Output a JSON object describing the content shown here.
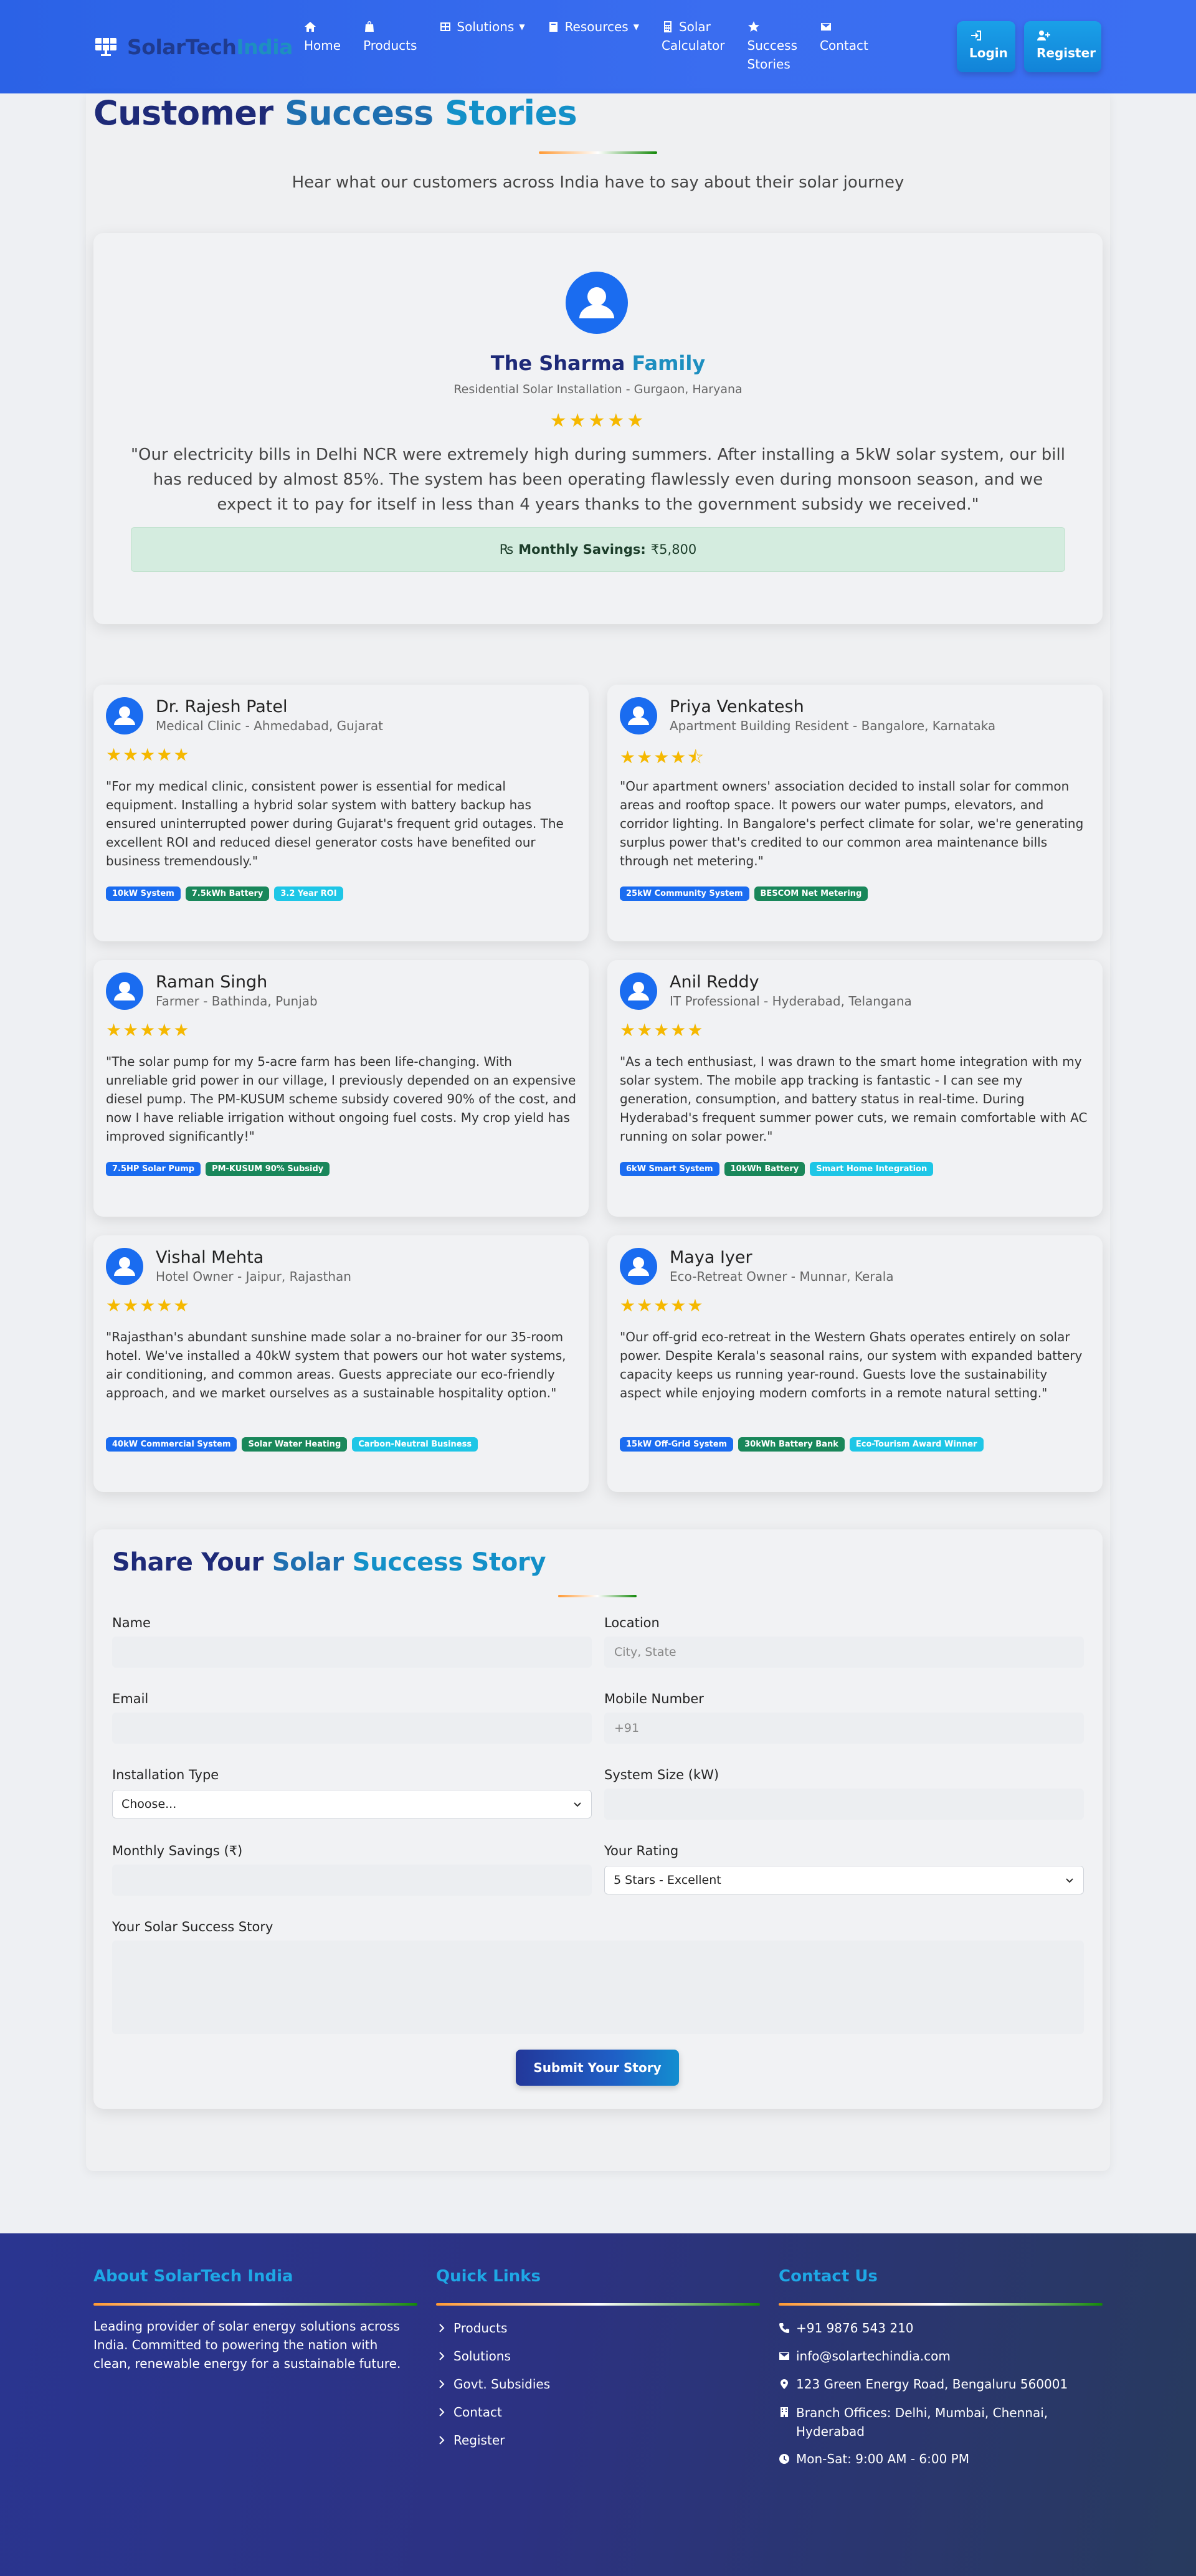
{
  "brand": {
    "name_part1": "SolarTech",
    "name_part2": "India"
  },
  "nav": {
    "items": [
      {
        "label": "Home",
        "icon": "home-icon"
      },
      {
        "label": "Products",
        "icon": "shopping-bag-icon"
      },
      {
        "label": "Solutions",
        "icon": "grid-icon",
        "dropdown": true
      },
      {
        "label": "Resources",
        "icon": "book-icon",
        "dropdown": true
      },
      {
        "label": "Solar",
        "label2": "Calculator",
        "icon": "calculator-icon"
      },
      {
        "label": "Success",
        "label2": "Stories",
        "icon": "star-icon"
      },
      {
        "label": "Contact",
        "icon": "envelope-icon"
      }
    ],
    "login": "Login",
    "register": "Register"
  },
  "page": {
    "title_part1": "Customer",
    "title_part2": "Success",
    "title_part3": "Stories",
    "subtitle": "Hear what our customers across India have to say about their solar journey"
  },
  "featured": {
    "name_part1": "The Sharma",
    "name_part2": "Family",
    "role": "Residential Solar Installation - Gurgaon, Haryana",
    "rating": 5,
    "stars": "★★★★★",
    "quote": "\"Our electricity bills in Delhi NCR were extremely high during summers. After installing a 5kW solar system, our bill has reduced by almost 85%. The system has been operating flawlessly even during monsoon season, and we expect it to pay for itself in less than 4 years thanks to the government subsidy we received.\"",
    "savings_label": "Monthly Savings:",
    "savings_value": "₹5,800",
    "savings_icon": "₨"
  },
  "testimonials": [
    {
      "name": "Dr. Rajesh Patel",
      "role": "Medical Clinic - Ahmedabad, Gujarat",
      "stars": "★★★★★",
      "rating": 5,
      "quote": "\"For my medical clinic, consistent power is essential for medical equipment. Installing a hybrid solar system with battery backup has ensured uninterrupted power during Gujarat's frequent grid outages. The excellent ROI and reduced diesel generator costs have benefited our business tremendously.\"",
      "tags": [
        "10kW System",
        "7.5kWh Battery",
        "3.2 Year ROI"
      ]
    },
    {
      "name": "Priya Venkatesh",
      "role": "Apartment Building Resident - Bangalore, Karnataka",
      "stars": "★★★★⯪",
      "rating": 4.5,
      "quote": "\"Our apartment owners' association decided to install solar for common areas and rooftop space. It powers our water pumps, elevators, and corridor lighting. In Bangalore's perfect climate for solar, we're generating surplus power that's credited to our common area maintenance bills through net metering.\"",
      "tags": [
        "25kW Community System",
        "BESCOM Net Metering"
      ]
    },
    {
      "name": "Raman Singh",
      "role": "Farmer - Bathinda, Punjab",
      "stars": "★★★★★",
      "rating": 5,
      "quote": "\"The solar pump for my 5-acre farm has been life-changing. With unreliable grid power in our village, I previously depended on an expensive diesel pump. The PM-KUSUM scheme subsidy covered 90% of the cost, and now I have reliable irrigation without ongoing fuel costs. My crop yield has improved significantly!\"",
      "tags": [
        "7.5HP Solar Pump",
        "PM-KUSUM 90% Subsidy"
      ]
    },
    {
      "name": "Anil Reddy",
      "role": "IT Professional - Hyderabad, Telangana",
      "stars": "★★★★★",
      "rating": 5,
      "quote": "\"As a tech enthusiast, I was drawn to the smart home integration with my solar system. The mobile app tracking is fantastic - I can see my generation, consumption, and battery status in real-time. During Hyderabad's frequent summer power cuts, we remain comfortable with AC running on solar power.\"",
      "tags": [
        "6kW Smart System",
        "10kWh Battery",
        "Smart Home Integration"
      ]
    },
    {
      "name": "Vishal Mehta",
      "role": "Hotel Owner - Jaipur, Rajasthan",
      "stars": "★★★★★",
      "rating": 5,
      "quote": "\"Rajasthan's abundant sunshine made solar a no-brainer for our 35-room hotel. We've installed a 40kW system that powers our hot water systems, air conditioning, and common areas. Guests appreciate our eco-friendly approach, and we market ourselves as a sustainable hospitality option.\"",
      "tags": [
        "40kW Commercial System",
        "Solar Water Heating",
        "Carbon-Neutral Business"
      ]
    },
    {
      "name": "Maya Iyer",
      "role": "Eco-Retreat Owner - Munnar, Kerala",
      "stars": "★★★★★",
      "rating": 5,
      "quote": "\"Our off-grid eco-retreat in the Western Ghats operates entirely on solar power. Despite Kerala's seasonal rains, our system with expanded battery capacity keeps us running year-round. Guests love the sustainability aspect while enjoying modern comforts in a remote natural setting.\"",
      "tags": [
        "15kW Off-Grid System",
        "30kWh Battery Bank",
        "Eco-Tourism Award Winner"
      ]
    }
  ],
  "form": {
    "title_part1": "Share Your",
    "title_part2": "Solar",
    "title_part3": "Success Story",
    "name_label": "Name",
    "location_label": "Location",
    "location_placeholder": "City, State",
    "email_label": "Email",
    "mobile_label": "Mobile Number",
    "mobile_placeholder": "+91",
    "installation_label": "Installation Type",
    "installation_value": "Choose...",
    "system_size_label": "System Size (kW)",
    "monthly_savings_label": "Monthly Savings (₹)",
    "rating_label": "Your Rating",
    "rating_value": "5 Stars - Excellent",
    "story_label": "Your Solar Success Story",
    "submit_label": "Submit Your Story"
  },
  "footer": {
    "about_title": "About SolarTech India",
    "about_text": "Leading provider of solar energy solutions across India. Committed to powering the nation with clean, renewable energy for a sustainable future.",
    "links_title": "Quick Links",
    "links": [
      "Products",
      "Solutions",
      "Govt. Subsidies",
      "Contact",
      "Register"
    ],
    "contact_title": "Contact Us",
    "phone": "+91 9876 543 210",
    "email": "info@solartechindia.com",
    "address": "123 Green Energy Road, Bengaluru 560001",
    "branches": "Branch Offices: Delhi, Mumbai, Chennai, Hyderabad",
    "hours": "Mon-Sat: 9:00 AM - 6:00 PM"
  },
  "colors": {
    "nav_bg": "#2b62e6",
    "accent_blue": "#1a6cf0",
    "star": "#f5b800",
    "tag_green": "#19875a",
    "tag_cyan": "#1ec6e6",
    "footer_bg": "#2a3590"
  }
}
